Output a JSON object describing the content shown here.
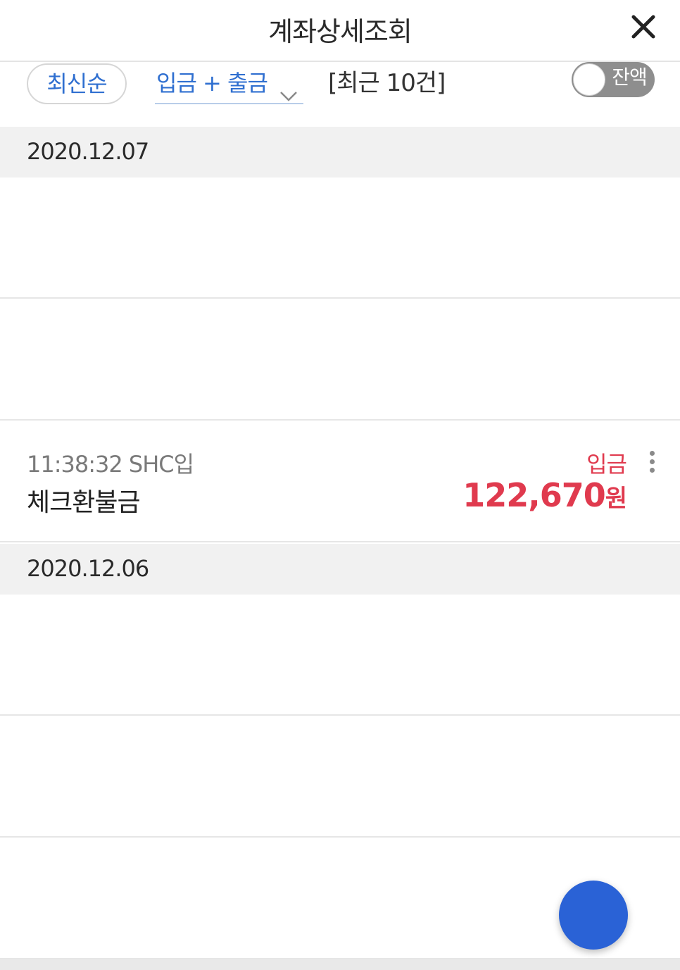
{
  "header": {
    "title": "계좌상세조회",
    "close_icon": "close-icon"
  },
  "filters": {
    "sort_label": "최신순",
    "type_label": "입금 + 출금",
    "type_icon": "chevron-down-icon",
    "recent_count_label": "[최근 10건]",
    "balance_toggle_label": "잔액",
    "balance_toggle_on": false
  },
  "groups": [
    {
      "date": "2020.12.07",
      "transactions": [
        {
          "time_memo": "",
          "description": "",
          "type": "",
          "amount": "",
          "unit": ""
        },
        {
          "time_memo": "",
          "description": "",
          "type": "",
          "amount": "",
          "unit": ""
        },
        {
          "time_memo": "11:38:32 SHC입",
          "description": "체크환불금",
          "type": "입금",
          "amount": "122,670",
          "unit": "원"
        }
      ]
    },
    {
      "date": "2020.12.06",
      "transactions": [
        {
          "time_memo": "",
          "description": "",
          "type": "",
          "amount": "",
          "unit": ""
        },
        {
          "time_memo": "",
          "description": "",
          "type": "",
          "amount": "",
          "unit": ""
        },
        {
          "time_memo": "",
          "description": "",
          "type": "",
          "amount": "",
          "unit": ""
        }
      ]
    }
  ],
  "colors": {
    "accent_blue": "#2f6fd0",
    "deposit_red": "#e03a4e",
    "fab_blue": "#2a62d6"
  }
}
